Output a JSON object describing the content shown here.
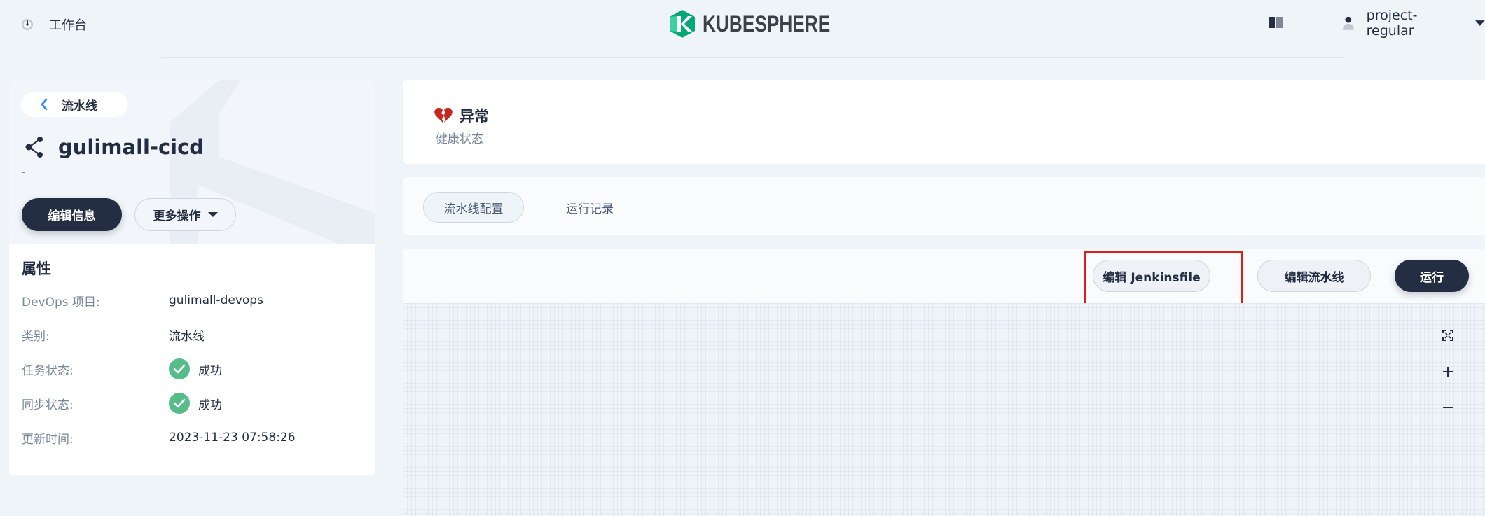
{
  "topbar": {
    "workbench_label": "工作台",
    "logo_text": "KUBESPHERE",
    "username": "project-regular"
  },
  "pipeline": {
    "back_label": "流水线",
    "name": "gulimall-cicd",
    "description": "-",
    "edit_info_label": "编辑信息",
    "more_ops_label": "更多操作"
  },
  "properties": {
    "title": "属性",
    "rows": [
      {
        "key": "DevOps 项目:",
        "value": "gulimall-devops"
      },
      {
        "key": "类别:",
        "value": "流水线"
      },
      {
        "key": "任务状态:",
        "value": "成功"
      },
      {
        "key": "同步状态:",
        "value": "成功"
      },
      {
        "key": "更新时间:",
        "value": "2023-11-23 07:58:26"
      }
    ]
  },
  "health": {
    "status": "异常",
    "label": "健康状态"
  },
  "tabs": [
    {
      "label": "流水线配置",
      "active": true
    },
    {
      "label": "运行记录",
      "active": false
    }
  ],
  "toolbar": {
    "edit_jenkinsfile_label": "编辑 Jenkinsfile",
    "edit_pipeline_label": "编辑流水线",
    "run_label": "运行"
  },
  "colors": {
    "dark": "#242e42",
    "success": "#55bc8a",
    "error": "#ca2621",
    "highlight": "#e01d1d"
  }
}
